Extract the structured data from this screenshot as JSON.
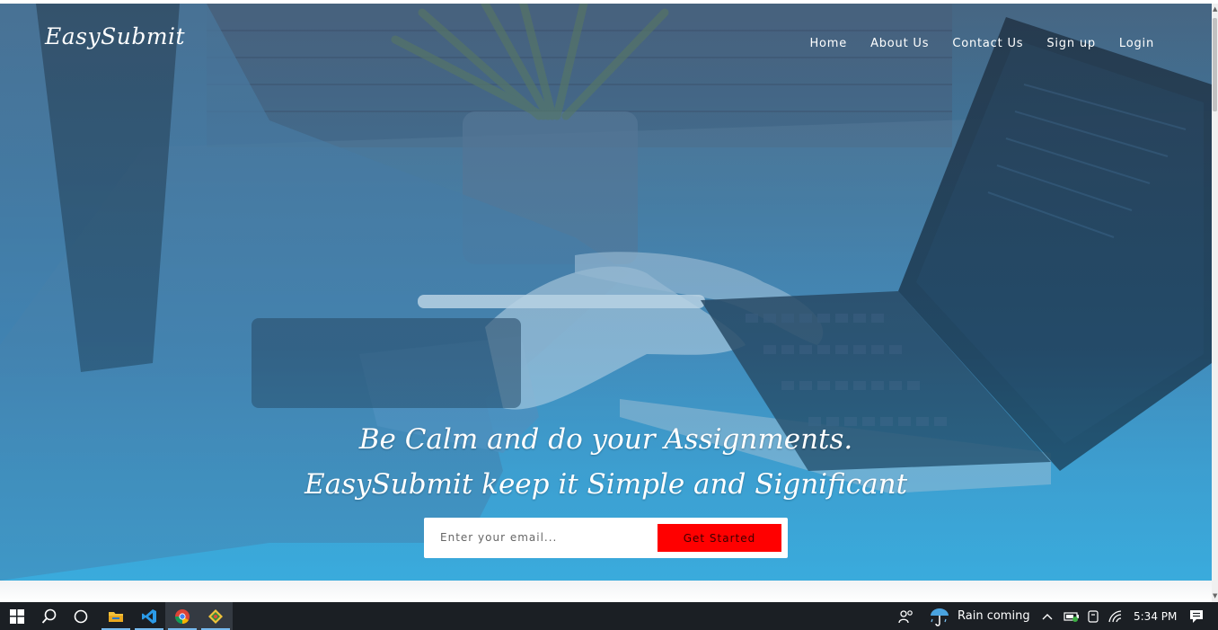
{
  "site": {
    "logo": "EasySubmit",
    "nav": [
      "Home",
      "About Us",
      "Contact Us",
      "Sign up",
      "Login"
    ],
    "tagline_line1": "Be Calm and do your Assignments.",
    "tagline_line2": "EasySubmit keep it Simple and Significant",
    "email_placeholder": "Enter your email...",
    "cta_label": "Get Started",
    "cta_color": "#ff0000"
  },
  "taskbar": {
    "apps": [
      "windows-start",
      "search",
      "task-view",
      "file-explorer",
      "vscode",
      "chrome",
      "git-client"
    ],
    "weather_text": "Rain coming",
    "time": "5:34 PM"
  }
}
